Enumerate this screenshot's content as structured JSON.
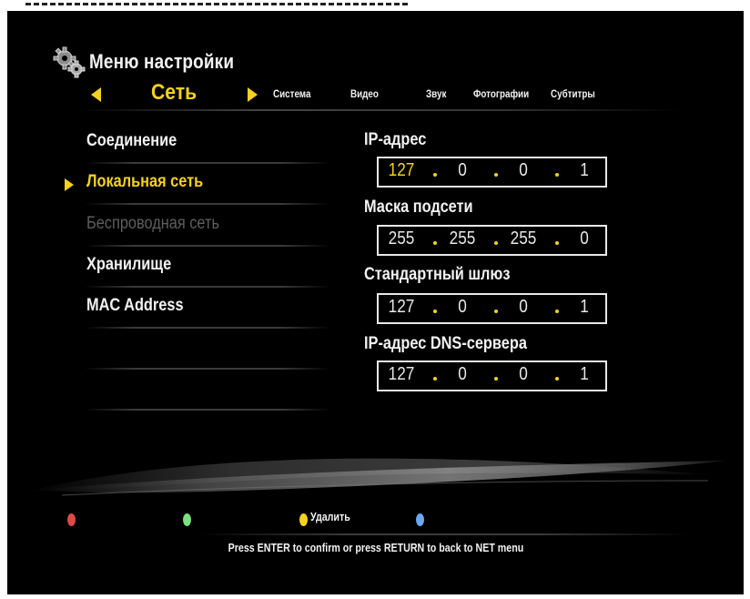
{
  "menu_title": "Меню настройки",
  "tabs": {
    "active": "Сеть",
    "items": [
      "Система",
      "Видео",
      "Звук",
      "Фотографии",
      "Субтитры"
    ]
  },
  "menu": {
    "items": [
      {
        "label": "Соединение",
        "state": "normal"
      },
      {
        "label": "Локальная сеть",
        "state": "selected"
      },
      {
        "label": "Беспроводная сеть",
        "state": "disabled"
      },
      {
        "label": "Хранилище",
        "state": "normal"
      },
      {
        "label": "MAC Address",
        "state": "normal"
      }
    ]
  },
  "fields": [
    {
      "label": "IP-адрес",
      "octets": [
        "127",
        "0",
        "0",
        "1"
      ]
    },
    {
      "label": "Маска подсети",
      "octets": [
        "255",
        "255",
        "255",
        "0"
      ]
    },
    {
      "label": "Стандартный шлюз",
      "octets": [
        "127",
        "0",
        "0",
        "1"
      ]
    },
    {
      "label": "IP-адрес DNS-сервера",
      "octets": [
        "127",
        "0",
        "0",
        "1"
      ]
    }
  ],
  "legend": {
    "red_label": "",
    "green_label": "",
    "yellow_label": "Удалить",
    "blue_label": ""
  },
  "help_text": "Press ENTER to confirm or press RETURN to back to NET menu",
  "colors": {
    "accent": "#f4d21e",
    "text": "#f2f2f2",
    "disabled": "#5e5e5e",
    "red_button": "#e04848",
    "green_button": "#7ee07e",
    "yellow_button": "#f4d21e",
    "blue_button": "#6aa8f0"
  },
  "icons": {
    "title": "gears-icon",
    "tab_prev": "triangle-left-icon",
    "tab_next": "triangle-right-icon",
    "cursor": "triangle-right-icon"
  }
}
